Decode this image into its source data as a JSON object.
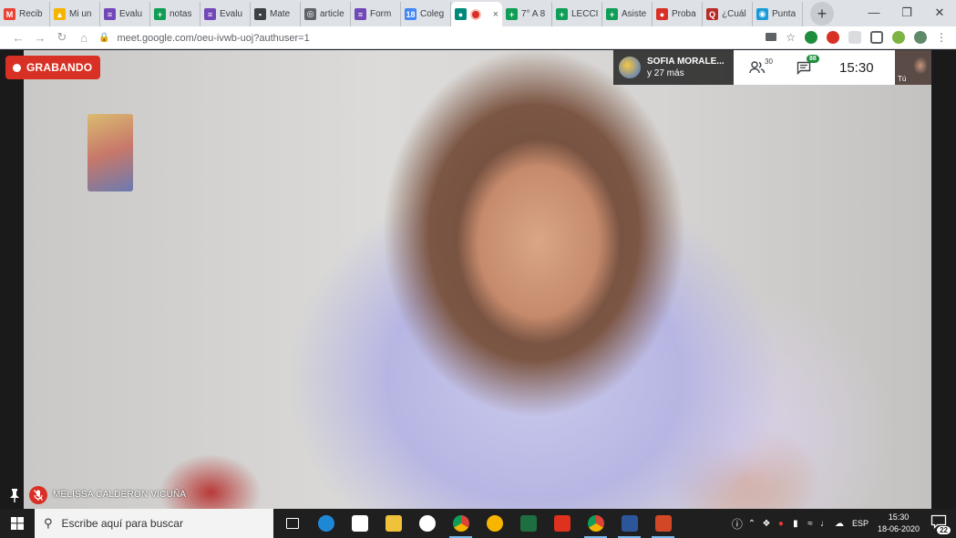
{
  "browser": {
    "tabs": [
      {
        "label": "Recib",
        "icon": "gmail-icon",
        "color": "#ea4335",
        "glyph": "M"
      },
      {
        "label": "Mi un",
        "icon": "drive-icon",
        "color": "#f4b400",
        "glyph": "▲"
      },
      {
        "label": "Evalu",
        "icon": "forms-icon",
        "color": "#7248b9",
        "glyph": "≡"
      },
      {
        "label": "notas",
        "icon": "sheets-icon",
        "color": "#0f9d58",
        "glyph": "+"
      },
      {
        "label": "Evalu",
        "icon": "forms-icon",
        "color": "#7248b9",
        "glyph": "≡"
      },
      {
        "label": "Mate",
        "icon": "classroom-icon",
        "color": "#3c4043",
        "glyph": "▪"
      },
      {
        "label": "article",
        "icon": "globe-icon",
        "color": "#5f6368",
        "glyph": "◎"
      },
      {
        "label": "Form",
        "icon": "forms-icon",
        "color": "#7248b9",
        "glyph": "≡"
      },
      {
        "label": "Coleg",
        "icon": "calendar-icon",
        "color": "#4285f4",
        "glyph": "18"
      },
      {
        "label": "",
        "icon": "meet-icon",
        "color": "#00897b",
        "glyph": "●",
        "active": true
      },
      {
        "label": "7° A 8",
        "icon": "sheets-icon",
        "color": "#0f9d58",
        "glyph": "+"
      },
      {
        "label": "LECCI",
        "icon": "sheets-icon",
        "color": "#0f9d58",
        "glyph": "+"
      },
      {
        "label": "Asiste",
        "icon": "sheets-icon",
        "color": "#0f9d58",
        "glyph": "+"
      },
      {
        "label": "Proba",
        "icon": "record-icon",
        "color": "#d93025",
        "glyph": "●"
      },
      {
        "label": "¿Cuál",
        "icon": "quora-icon",
        "color": "#b92b27",
        "glyph": "Q"
      },
      {
        "label": "Punta",
        "icon": "site-icon",
        "color": "#1a9bd7",
        "glyph": "◉"
      }
    ],
    "url": "meet.google.com/oeu-ivwb-uoj?authuser=1",
    "tab_close_glyph": "×",
    "new_tab_glyph": "+"
  },
  "meet": {
    "recording_label": "GRABANDO",
    "presenter_name": "SOFIA MORALE...",
    "presenter_more": "y 27 más",
    "participants_count": "30",
    "chat_badge": "88",
    "clock": "15:30",
    "self_label": "Tú",
    "speaker_name": "MELISSA CALDERON VICUÑA"
  },
  "taskbar": {
    "search_placeholder": "Escribe aquí para buscar",
    "apps": [
      {
        "name": "task-view-icon",
        "color": "#1f1f1f",
        "open": false
      },
      {
        "name": "edge-icon",
        "color": "#1e88d7",
        "open": false
      },
      {
        "name": "store-icon",
        "color": "#ffffff",
        "open": false
      },
      {
        "name": "file-explorer-icon",
        "color": "#f0c23a",
        "open": false
      },
      {
        "name": "google-icon",
        "color": "#ffffff",
        "open": false
      },
      {
        "name": "chrome-icon",
        "color": "#db4437",
        "open": true
      },
      {
        "name": "weather-icon",
        "color": "#f7b500",
        "open": false
      },
      {
        "name": "excel-icon",
        "color": "#1d6f42",
        "open": false
      },
      {
        "name": "acrobat-icon",
        "color": "#e0301e",
        "open": false
      },
      {
        "name": "chrome-icon",
        "color": "#db4437",
        "open": true
      },
      {
        "name": "word-icon",
        "color": "#2b579a",
        "open": true
      },
      {
        "name": "powerpoint-icon",
        "color": "#d24726",
        "open": true
      }
    ],
    "language": "ESP",
    "time": "15:30",
    "date": "18-06-2020",
    "notification_count": "22"
  }
}
